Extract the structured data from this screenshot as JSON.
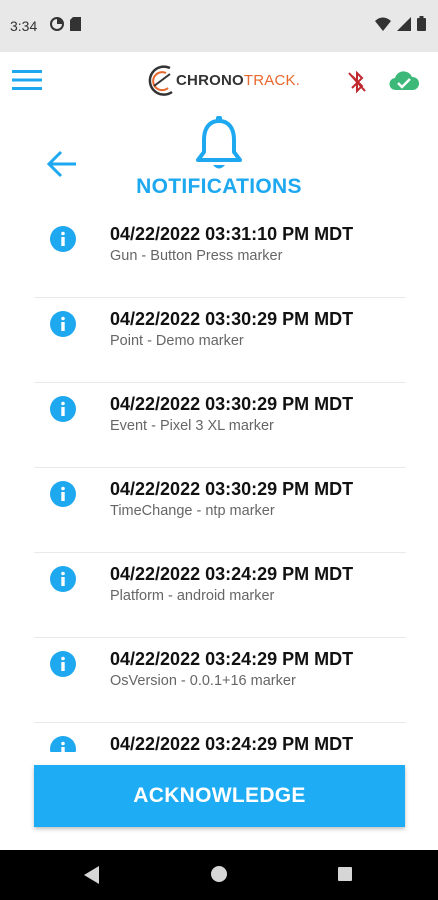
{
  "status_bar": {
    "time": "3:34"
  },
  "app_bar": {
    "logo_part1": "CHRONO",
    "logo_part2": "TRACK.",
    "icons": [
      "menu-icon",
      "bluetooth-disabled-icon",
      "cloud-check-icon"
    ],
    "accent_color": "#1ea8f0"
  },
  "header": {
    "title": "NOTIFICATIONS",
    "icons": [
      "back-arrow-icon",
      "bell-icon"
    ]
  },
  "notifications": [
    {
      "timestamp": "04/22/2022 03:31:10 PM MDT",
      "message": "Gun - Button Press marker"
    },
    {
      "timestamp": "04/22/2022 03:30:29 PM MDT",
      "message": "Point - Demo marker"
    },
    {
      "timestamp": "04/22/2022 03:30:29 PM MDT",
      "message": "Event - Pixel 3 XL marker"
    },
    {
      "timestamp": "04/22/2022 03:30:29 PM MDT",
      "message": "TimeChange - ntp marker"
    },
    {
      "timestamp": "04/22/2022 03:24:29 PM MDT",
      "message": "Platform - android marker"
    },
    {
      "timestamp": "04/22/2022 03:24:29 PM MDT",
      "message": "OsVersion - 0.0.1+16 marker"
    },
    {
      "timestamp": "04/22/2022 03:24:29 PM MDT",
      "message": ""
    }
  ],
  "acknowledge_button": {
    "label": "ACKNOWLEDGE",
    "color": "#1eacf4"
  },
  "nav_bar": {
    "icons": [
      "nav-back-icon",
      "nav-home-icon",
      "nav-recents-icon"
    ]
  }
}
